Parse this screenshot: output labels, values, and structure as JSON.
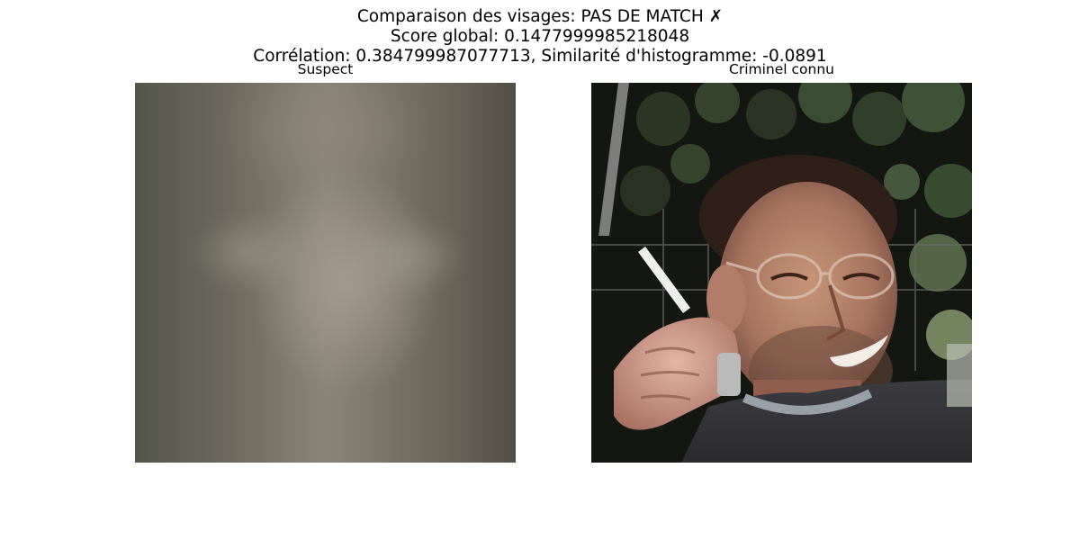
{
  "figure": {
    "title_line1": "Comparaison des visages: PAS DE MATCH ✗",
    "title_line2": "Score global: 0.1477999985218048",
    "title_line3": "Corrélation: 0.384799987077713, Similarité d'histogramme: -0.0891"
  },
  "panels": {
    "left": {
      "title": "Suspect"
    },
    "right": {
      "title": "Criminel connu"
    }
  }
}
